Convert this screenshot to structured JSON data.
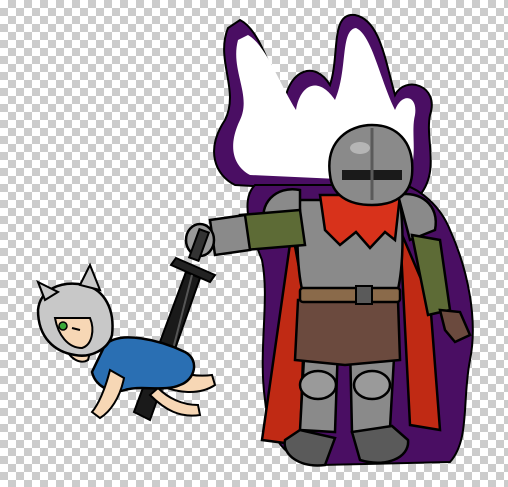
{
  "canvas": {
    "background": "transparency-checkerboard",
    "checker_light": "#ffffff",
    "checker_dark": "#cccccc"
  },
  "illustration": {
    "subjects": [
      "armored-knight",
      "cat-eared-child",
      "black-sword"
    ],
    "colors": {
      "aura_purple": "#4a0e63",
      "armor_grey": "#8a8a8a",
      "armor_dark": "#5a5a5a",
      "tabard_red": "#d8321b",
      "cape_red": "#c02a14",
      "sleeve_olive": "#5d6b36",
      "trousers_brown": "#6b4a3e",
      "belt_brown": "#8a6a4a",
      "dress_blue": "#2a6fb3",
      "hair_silver": "#c8c8c8",
      "skin": "#f7d7b5",
      "eye_green": "#3aa83a",
      "outline": "#000000"
    }
  }
}
